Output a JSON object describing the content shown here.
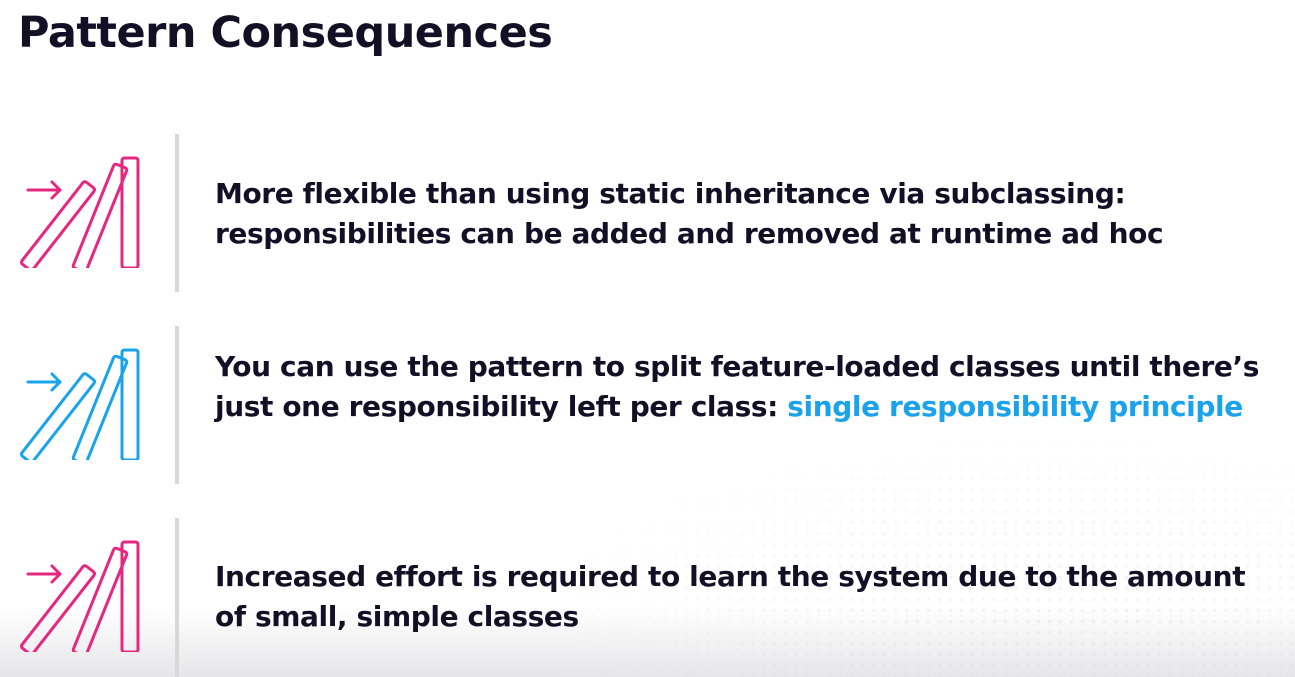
{
  "slide": {
    "title": "Pattern Consequences"
  },
  "colors": {
    "pink": "#e5277f",
    "blue": "#1aa3ec",
    "text": "#130f25",
    "divider": "#d8d8dc"
  },
  "items": [
    {
      "icon": "dominoes-pink-icon",
      "text": "More flexible than using static inheritance via subclassing: responsibilities can be added and removed at runtime ad hoc",
      "highlight": ""
    },
    {
      "icon": "dominoes-blue-icon",
      "text": "You can use the pattern to split feature-loaded classes until there’s just one responsibility left per class: ",
      "highlight": "single responsibility principle"
    },
    {
      "icon": "dominoes-pink-icon",
      "text": "Increased effort is required to learn the system due to the amount of small, simple classes",
      "highlight": ""
    }
  ]
}
